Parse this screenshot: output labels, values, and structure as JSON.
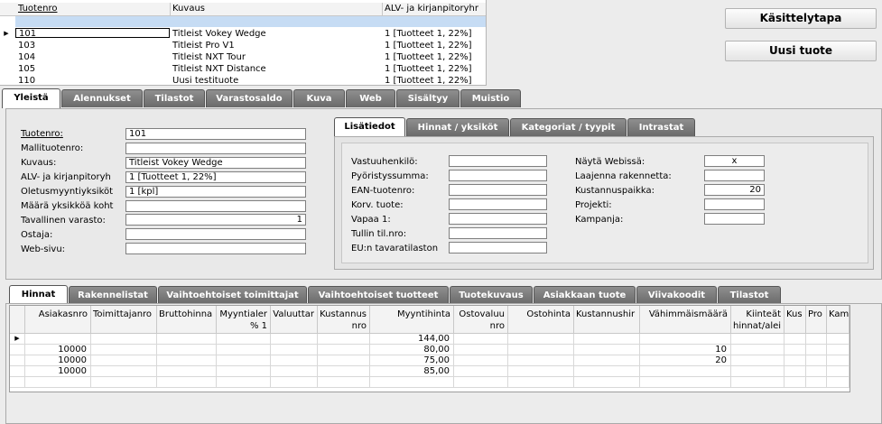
{
  "product_list": {
    "columns": [
      "Tuotenro",
      "Kuvaus",
      "ALV- ja kirjanpitoryhr"
    ],
    "rows": [
      {
        "nro": "101",
        "kuvaus": "Titleist Vokey Wedge",
        "alv": "1 [Tuotteet 1, 22%]"
      },
      {
        "nro": "103",
        "kuvaus": "Titleist Pro V1",
        "alv": "1 [Tuotteet 1, 22%]"
      },
      {
        "nro": "104",
        "kuvaus": "Titleist NXT Tour",
        "alv": "1 [Tuotteet 1, 22%]"
      },
      {
        "nro": "105",
        "kuvaus": "Titleist NXT Distance",
        "alv": "1 [Tuotteet 1, 22%]"
      },
      {
        "nro": "110",
        "kuvaus": "Uusi testituote",
        "alv": "1 [Tuotteet 1, 22%]"
      }
    ]
  },
  "buttons": {
    "kasittelytapa": "Käsittelytapa",
    "uusi_tuote": "Uusi tuote"
  },
  "main_tabs": [
    "Yleistä",
    "Alennukset",
    "Tilastot",
    "Varastosaldo",
    "Kuva",
    "Web",
    "Sisältyy",
    "Muistio"
  ],
  "general": {
    "fields": [
      {
        "label": "Tuotenro:",
        "value": ""
      },
      {
        "label": "Mallituotenro:",
        "value": ""
      },
      {
        "label": "Kuvaus:",
        "value": "Titleist Vokey Wedge"
      },
      {
        "label": "ALV- ja kirjanpitoryh",
        "value": "1 [Tuotteet 1, 22%]"
      },
      {
        "label": "Oletusmyyntiyksiköt",
        "value": "1 [kpl]"
      },
      {
        "label": "Määrä yksikköä koht",
        "value": ""
      },
      {
        "label": "Tavallinen varasto:",
        "value": "1"
      },
      {
        "label": "Ostaja:",
        "value": ""
      },
      {
        "label": "Web-sivu:",
        "value": ""
      }
    ],
    "tuotenro_value": "101"
  },
  "sub_tabs": [
    "Lisätiedot",
    "Hinnat / yksiköt",
    "Kategoriat / tyypit",
    "Intrastat"
  ],
  "lisatiedot": {
    "left": [
      {
        "label": "Vastuuhenkilö:",
        "value": ""
      },
      {
        "label": "Pyöristyssumma:",
        "value": ""
      },
      {
        "label": "EAN-tuotenro:",
        "value": ""
      },
      {
        "label": "Korv. tuote:",
        "value": ""
      },
      {
        "label": "Vapaa 1:",
        "value": ""
      },
      {
        "label": "Tullin til.nro:",
        "value": ""
      },
      {
        "label": "EU:n tavaratilaston",
        "value": ""
      }
    ],
    "right": [
      {
        "label": "Näytä Webissä:",
        "value": "x"
      },
      {
        "label": "Laajenna rakennetta:",
        "value": ""
      },
      {
        "label": "Kustannuspaikka:",
        "value": "20"
      },
      {
        "label": "Projekti:",
        "value": ""
      },
      {
        "label": "Kampanja:",
        "value": ""
      }
    ]
  },
  "bottom_tabs": [
    "Hinnat",
    "Rakennelistat",
    "Vaihtoehtoiset toimittajat",
    "Vaihtoehtoiset tuotteet",
    "Tuotekuvaus",
    "Asiakkaan tuote",
    "Viivakoodit",
    "Tilastot"
  ],
  "price_grid": {
    "columns": [
      "Asiakasnro",
      "Toimittajanro",
      "Bruttohinna",
      "Myyntialer % 1",
      "Valuuttar",
      "Kustannus nro",
      "Myyntihinta",
      "Ostovaluu nro",
      "Ostohinta",
      "Kustannushir",
      "Vähimmäismäärä",
      "Kiinteät hinnat/alei",
      "Kus",
      "Pro",
      "Kam"
    ],
    "rows": [
      {
        "asiakasnro": "",
        "myyntihinta": "144,00",
        "vahimmaismaara": ""
      },
      {
        "asiakasnro": "10000",
        "myyntihinta": "80,00",
        "vahimmaismaara": "10"
      },
      {
        "asiakasnro": "10000",
        "myyntihinta": "75,00",
        "vahimmaismaara": "20"
      },
      {
        "asiakasnro": "10000",
        "myyntihinta": "85,00",
        "vahimmaismaara": ""
      }
    ]
  }
}
